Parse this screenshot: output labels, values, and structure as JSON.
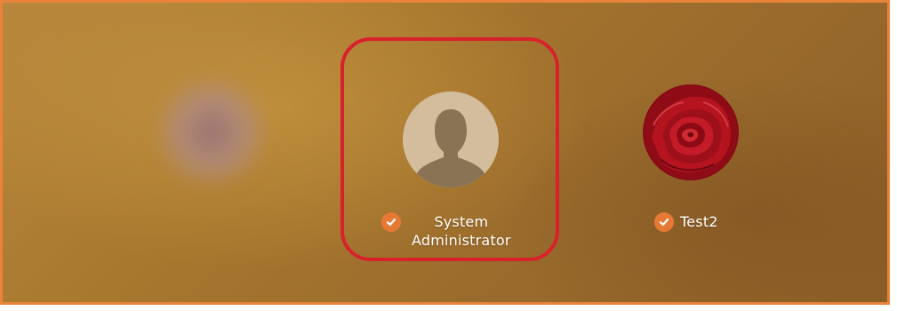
{
  "users": [
    {
      "name_line1": "System",
      "name_line2": "Administrator",
      "avatar_icon": "person-silhouette-icon",
      "selected": true,
      "logged_in_check": "checkmark-icon"
    },
    {
      "name": "Test2",
      "avatar_icon": "rose-avatar-icon",
      "selected": false,
      "logged_in_check": "checkmark-icon"
    }
  ],
  "colors": {
    "selection_border": "#d9212c",
    "check_badge": "#e67a35",
    "frame_border": "#e8843a"
  }
}
